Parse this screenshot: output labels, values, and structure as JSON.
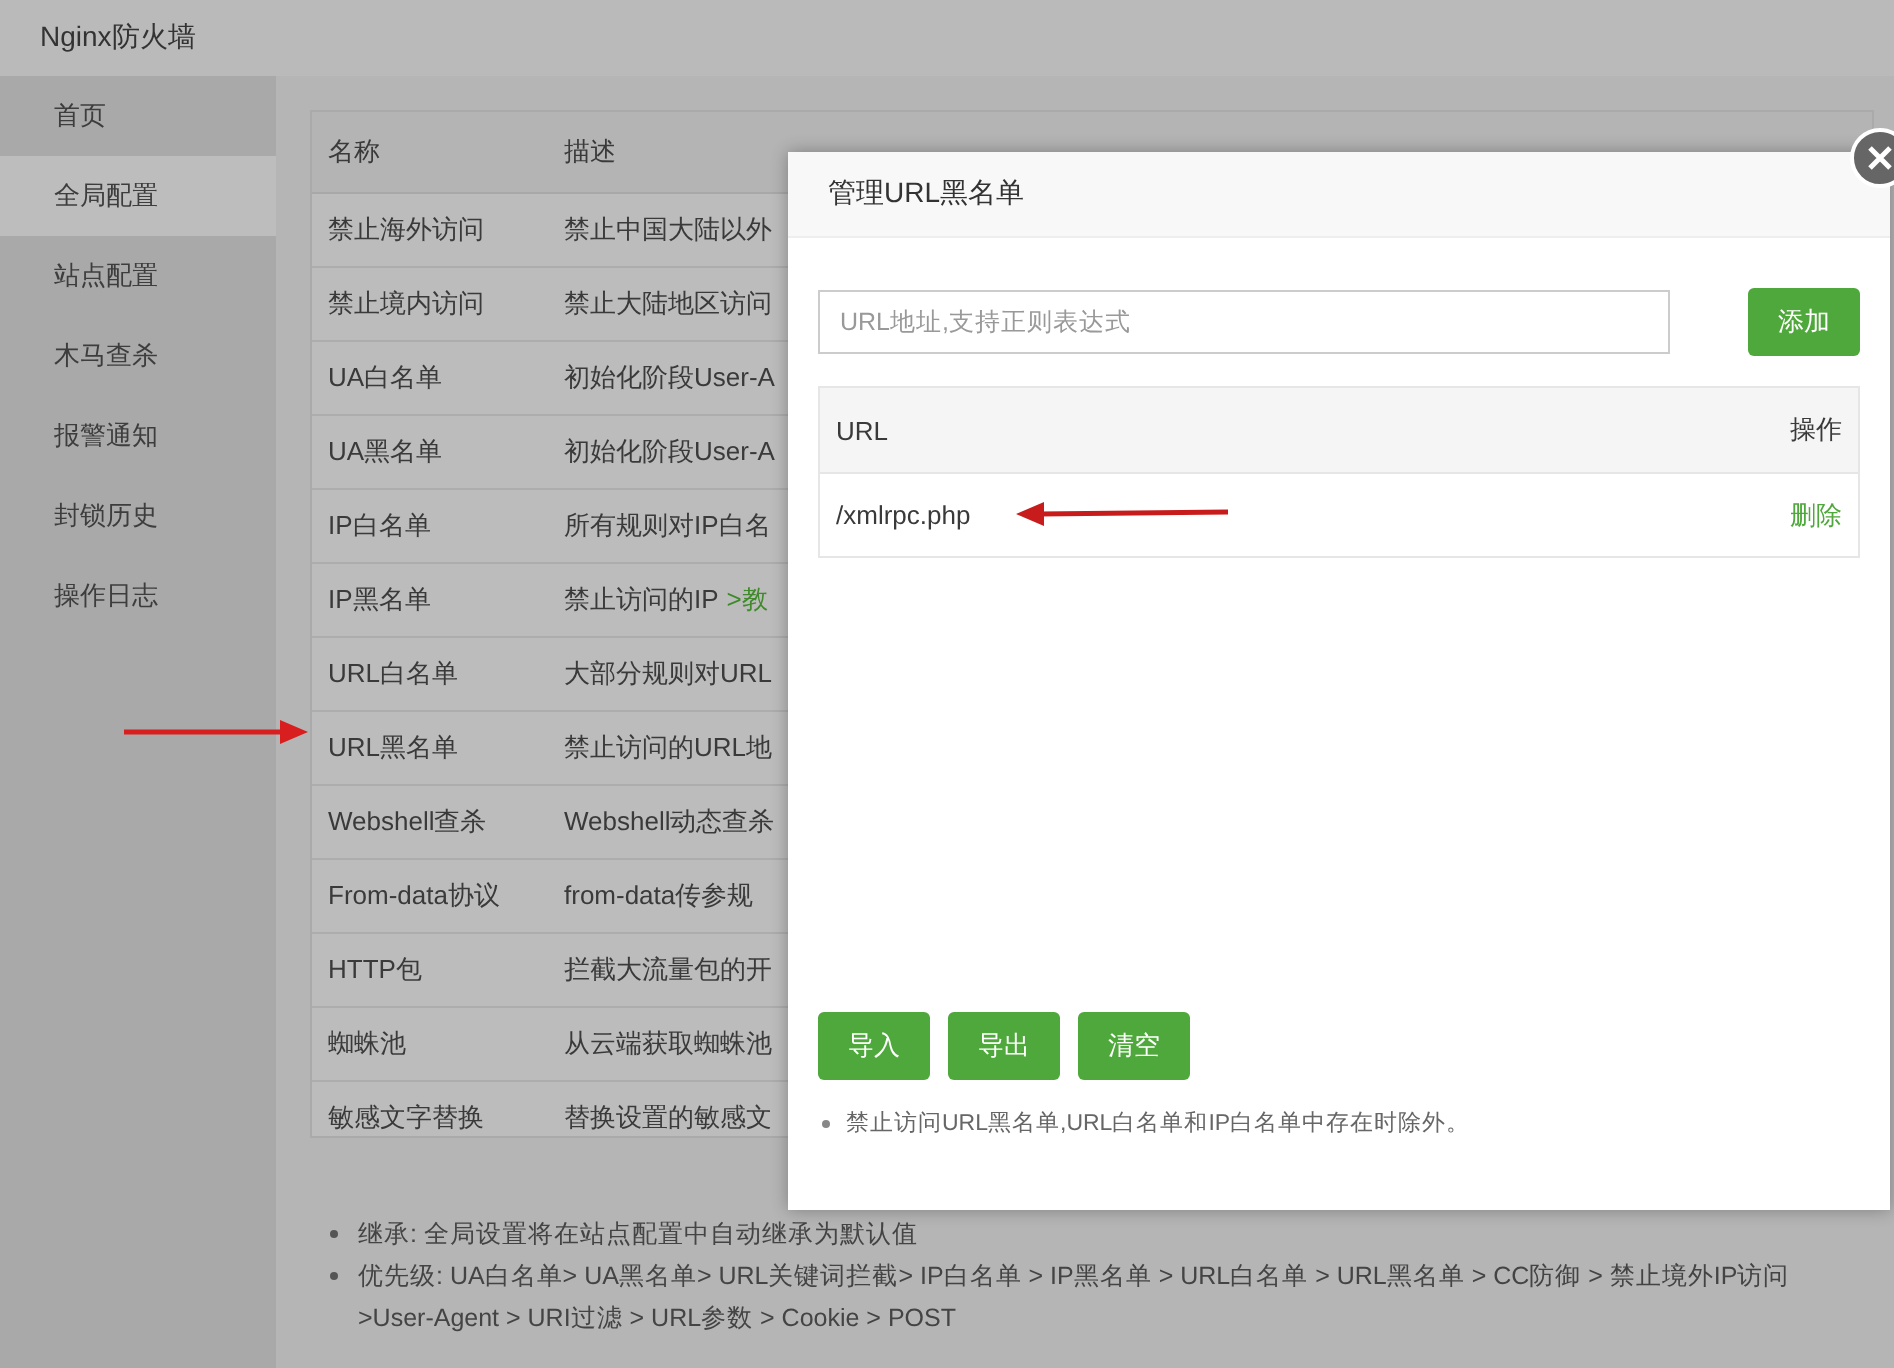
{
  "window": {
    "title": "Nginx防火墙"
  },
  "sidebar": {
    "items": [
      {
        "label": "首页",
        "selected": false
      },
      {
        "label": "全局配置",
        "selected": true
      },
      {
        "label": "站点配置",
        "selected": false
      },
      {
        "label": "木马查杀",
        "selected": false
      },
      {
        "label": "报警通知",
        "selected": false
      },
      {
        "label": "封锁历史",
        "selected": false
      },
      {
        "label": "操作日志",
        "selected": false
      }
    ]
  },
  "table": {
    "columns": [
      "名称",
      "描述"
    ],
    "rows": [
      {
        "name": "禁止海外访问",
        "description": "禁止中国大陆以外"
      },
      {
        "name": "禁止境内访问",
        "description": "禁止大陆地区访问"
      },
      {
        "name": "UA白名单",
        "description": "初始化阶段User-A"
      },
      {
        "name": "UA黑名单",
        "description": "初始化阶段User-A"
      },
      {
        "name": "IP白名单",
        "description": "所有规则对IP白名"
      },
      {
        "name": "IP黑名单",
        "description": "禁止访问的IP",
        "link": ">教"
      },
      {
        "name": "URL白名单",
        "description": "大部分规则对URL"
      },
      {
        "name": "URL黑名单",
        "description": "禁止访问的URL地",
        "annotated": true
      },
      {
        "name": "Webshell查杀",
        "description": "Webshell动态查杀"
      },
      {
        "name": "From-data协议",
        "description": "from-data传参规"
      },
      {
        "name": "HTTP包",
        "description": "拦截大流量包的开"
      },
      {
        "name": "蜘蛛池",
        "description": "从云端获取蜘蛛池"
      },
      {
        "name": "敏感文字替换",
        "description": "替换设置的敏感文"
      }
    ]
  },
  "notes": [
    "继承: 全局设置将在站点配置中自动继承为默认值",
    "优先级: UA白名单> UA黑名单> URL关键词拦截> IP白名单 > IP黑名单 > URL白名单 > URL黑名单 > CC防御 > 禁止境外IP访问 >User-Agent > URI过滤 > URL参数 > Cookie > POST"
  ],
  "dialog": {
    "title": "管理URL黑名单",
    "input": {
      "placeholder": "URL地址,支持正则表达式"
    },
    "add_button": "添加",
    "columns": [
      "URL",
      "操作"
    ],
    "rows": [
      {
        "url": "/xmlrpc.php",
        "action": "删除",
        "annotated": true
      }
    ],
    "buttons": [
      "导入",
      "导出",
      "清空"
    ],
    "note": "禁止访问URL黑名单,URL白名单和IP白名单中存在时除外。"
  }
}
